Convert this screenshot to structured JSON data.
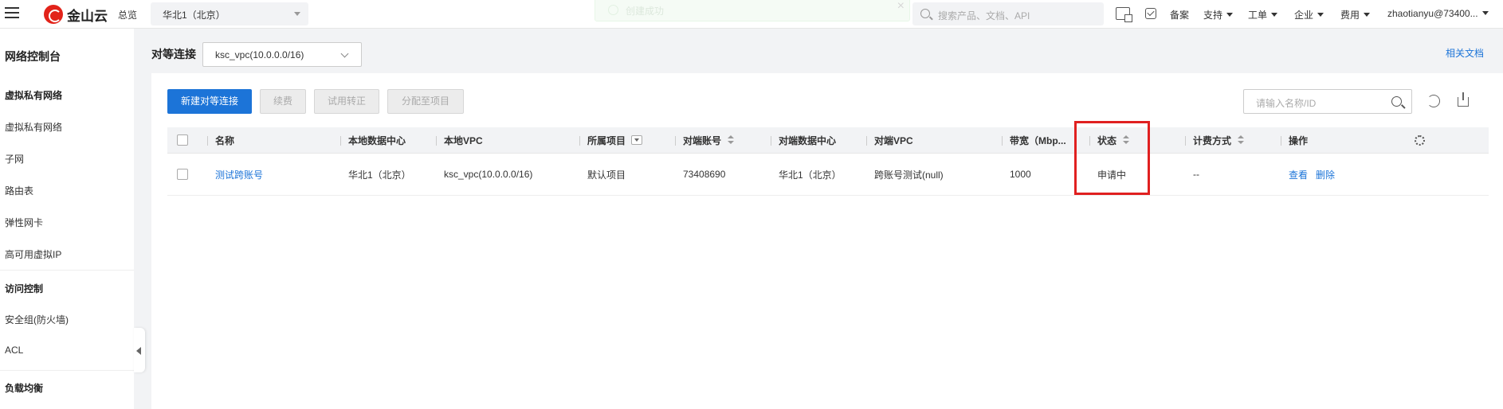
{
  "topbar": {
    "brand": "金山云",
    "overview": "总览",
    "region": "华北1（北京）",
    "toast": "创建成功",
    "search_placeholder": "搜索产品、文档、API",
    "links": [
      "备案",
      "支持",
      "工单",
      "企业",
      "费用"
    ],
    "user": "zhaotianyu@73400..."
  },
  "sidebar": {
    "title": "网络控制台",
    "groups": [
      {
        "label": "虚拟私有网络",
        "items": [
          "虚拟私有网络",
          "子网",
          "路由表",
          "弹性网卡",
          "高可用虚拟IP"
        ]
      },
      {
        "label": "访问控制",
        "items": [
          "安全组(防火墙)",
          "ACL"
        ]
      },
      {
        "label": "负载均衡",
        "items": []
      }
    ]
  },
  "header": {
    "label": "对等连接",
    "vpc": "ksc_vpc(10.0.0.0/16)",
    "docs": "相关文档"
  },
  "toolbar": {
    "create": "新建对等连接",
    "renew": "续费",
    "trial": "试用转正",
    "assign": "分配至项目",
    "search_placeholder": "请输入名称/ID"
  },
  "table": {
    "headers": [
      "名称",
      "本地数据中心",
      "本地VPC",
      "所属项目",
      "对端账号",
      "对端数据中心",
      "对端VPC",
      "带宽（Mbp...",
      "状态",
      "计费方式",
      "操作"
    ],
    "rows": [
      {
        "name": "测试跨账号",
        "local_dc": "华北1（北京）",
        "local_vpc": "ksc_vpc(10.0.0.0/16)",
        "project": "默认项目",
        "peer_account": "73408690",
        "peer_dc": "华北1（北京）",
        "peer_vpc": "跨账号测试(null)",
        "bandwidth": "1000",
        "status": "申请中",
        "billing": "--",
        "ops": [
          "查看",
          "删除"
        ]
      }
    ]
  },
  "colors": {
    "accent": "#1c74d8",
    "highlight": "#e02020",
    "brand": "#e2231a"
  }
}
